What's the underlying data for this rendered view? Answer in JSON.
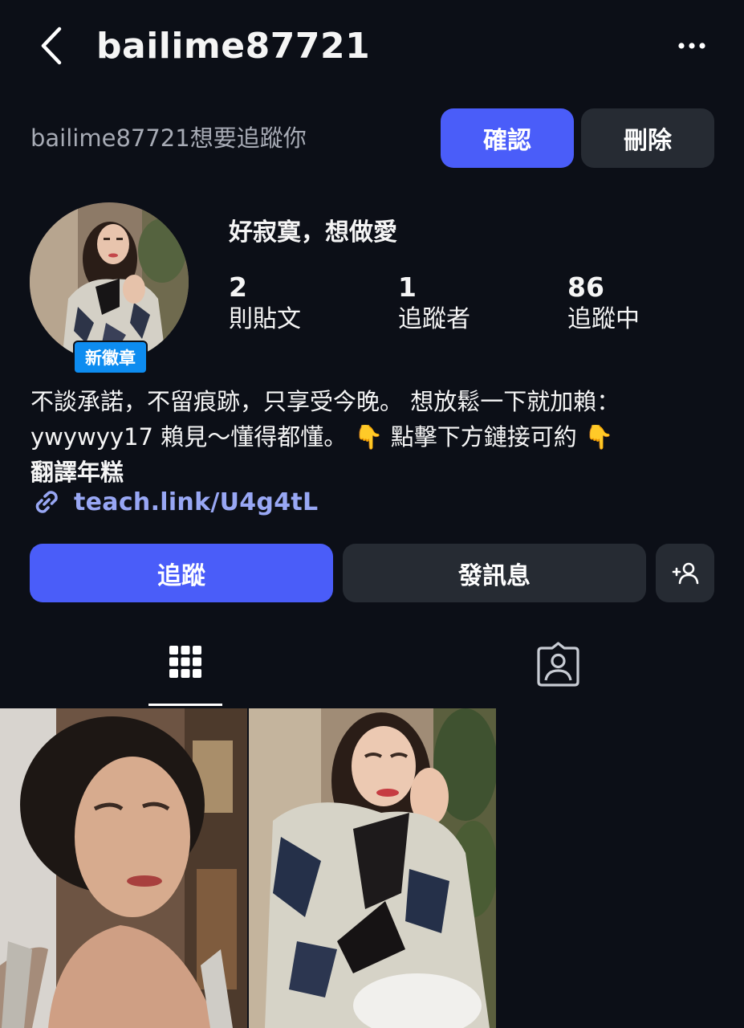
{
  "header": {
    "username": "bailime87721"
  },
  "follow_request": {
    "text": "bailime87721想要追蹤你",
    "confirm_label": "確認",
    "delete_label": "刪除"
  },
  "profile": {
    "badge": "新徽章",
    "display_name": "好寂寞，想做愛",
    "stats": [
      {
        "value": "2",
        "label": "則貼文"
      },
      {
        "value": "1",
        "label": "追蹤者"
      },
      {
        "value": "86",
        "label": "追蹤中"
      }
    ],
    "bio_line1": "不談承諾，不留痕跡，只享受今晚。 想放鬆一下就加賴：",
    "bio_line2": "ywywyy17 賴見～懂得都懂。 👇 點擊下方鏈接可約 👇",
    "bio_translate": "翻譯年糕",
    "link": "teach.link/U4g4tL"
  },
  "actions": {
    "follow_label": "追蹤",
    "message_label": "發訊息"
  },
  "colors": {
    "background": "#0c0f17",
    "primary": "#4a5df9",
    "secondary_button": "#262b33",
    "badge": "#0d8cf0",
    "link": "#98a7f4"
  },
  "icons": [
    "back-chevron-icon",
    "more-options-icon",
    "link-icon",
    "add-user-icon",
    "grid-icon",
    "tagged-person-icon"
  ]
}
